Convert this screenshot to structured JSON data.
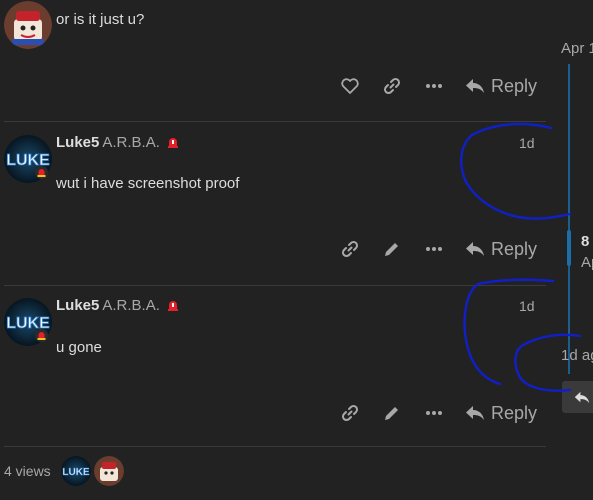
{
  "posts": [
    {
      "text": "or is it just u?",
      "actions": [
        "like-icon",
        "link-icon",
        "more-icon"
      ],
      "reply_label": "Reply"
    },
    {
      "username": "Luke5",
      "fullname": "A.R.B.A.",
      "date": "1d",
      "text": "wut i have screenshot proof",
      "actions": [
        "link-icon",
        "edit-icon",
        "more-icon"
      ],
      "reply_label": "Reply"
    },
    {
      "username": "Luke5",
      "fullname": "A.R.B.A.",
      "date": "1d",
      "text": "u gone",
      "actions": [
        "link-icon",
        "edit-icon",
        "more-icon"
      ],
      "reply_label": "Reply"
    }
  ],
  "avatar_text": "LUKE",
  "timeline": {
    "start_date": "Apr 1",
    "position_count": "8",
    "position_date": "Ap",
    "end_date": "1d ag"
  },
  "footer": {
    "views": "4 views"
  },
  "colors": {
    "background": "#222222",
    "accent": "#1a5f8e",
    "annotation": "#1020c8",
    "flair": "#e4202a"
  }
}
